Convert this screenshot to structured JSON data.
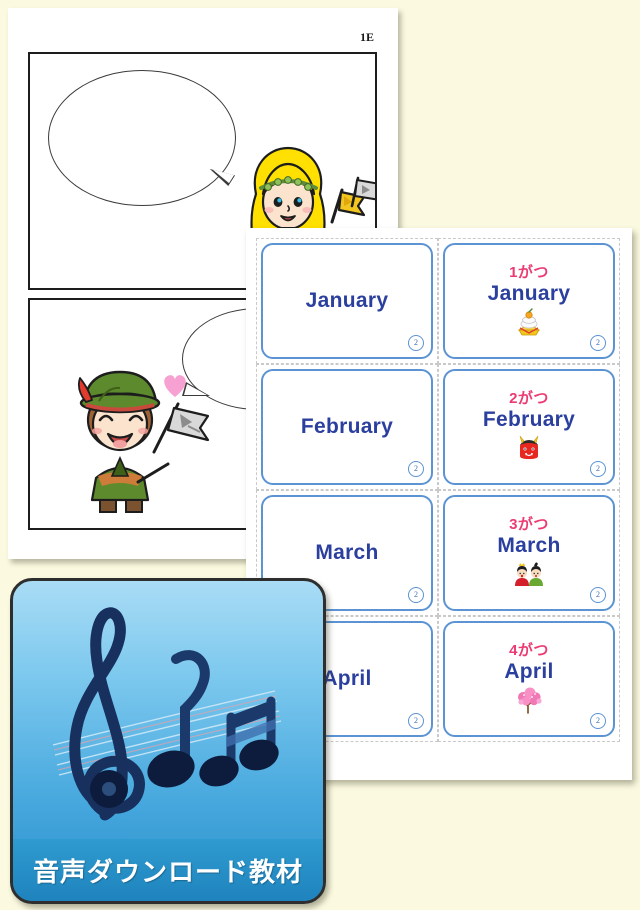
{
  "worksheet": {
    "code": "1E",
    "panels": [
      {
        "name": "top-panel",
        "bubble": "empty-speech-bubble",
        "character": "blonde-girl-with-flag"
      },
      {
        "name": "bottom-panel",
        "bubble": "empty-speech-bubble",
        "character": "boy-in-green-hat-with-map",
        "decor": "pink-heart"
      }
    ]
  },
  "card_sheet": {
    "badge_label": "2",
    "cards": [
      {
        "jp": "",
        "en": "January",
        "illus": "",
        "badge": "2"
      },
      {
        "jp": "1がつ",
        "en": "January",
        "illus": "kagami-mochi",
        "badge": "2"
      },
      {
        "jp": "",
        "en": "February",
        "illus": "",
        "badge": "2"
      },
      {
        "jp": "2がつ",
        "en": "February",
        "illus": "red-oni",
        "badge": "2"
      },
      {
        "jp": "",
        "en": "March",
        "illus": "",
        "badge": "2"
      },
      {
        "jp": "3がつ",
        "en": "March",
        "illus": "hina-dolls",
        "badge": "2"
      },
      {
        "jp": "",
        "en": "April",
        "illus": "",
        "badge": "2"
      },
      {
        "jp": "4がつ",
        "en": "April",
        "illus": "cherry-blossom-tree",
        "badge": "2"
      }
    ]
  },
  "audio_tile": {
    "label": "音声ダウンロード教材",
    "icon": "treble-clef-music-notes"
  },
  "colors": {
    "background": "#fbfae0",
    "card_border": "#5b93d3",
    "card_english_text": "#2b3f9e",
    "card_japanese_text": "#ec3b72",
    "tile_blue": "#2e9bd0"
  }
}
